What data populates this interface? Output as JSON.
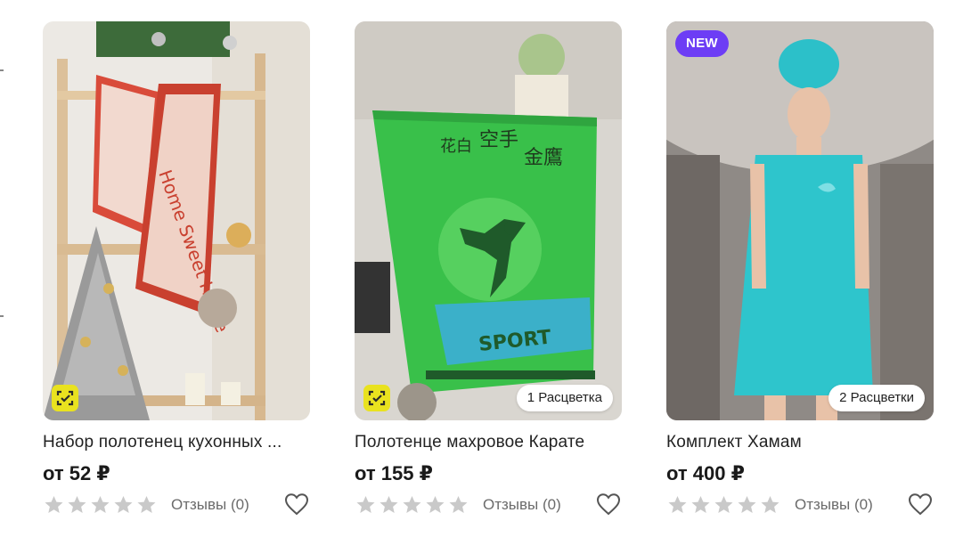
{
  "colors": {
    "accent_new": "#6d3df5",
    "scan_badge": "#e9e21f",
    "star_empty": "#c9c9c9",
    "muted_text": "#6b6b6b"
  },
  "products": [
    {
      "title": "Набор полотенец кухонных ...",
      "price": "от 52 ₽",
      "rating_stars": 0,
      "reviews_label": "Отзывы (0)",
      "badge": "",
      "colors_label": "",
      "image_text": "Home Sweet Home",
      "has_scan_badge": true
    },
    {
      "title": "Полотенце махровое Карате",
      "price": "от 155 ₽",
      "rating_stars": 0,
      "reviews_label": "Отзывы (0)",
      "badge": "",
      "colors_label": "1 Расцветка",
      "image_text": "SPORT",
      "has_scan_badge": true
    },
    {
      "title": "Комплект Хамам",
      "price": "от 400 ₽",
      "rating_stars": 0,
      "reviews_label": "Отзывы (0)",
      "badge": "NEW",
      "colors_label": "2 Расцветки",
      "image_text": "",
      "has_scan_badge": false
    }
  ]
}
